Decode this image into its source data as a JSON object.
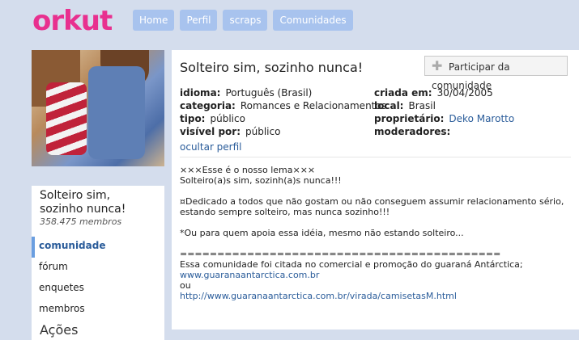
{
  "logo": "orkut",
  "nav": [
    "Home",
    "Perfil",
    "scraps",
    "Comunidades"
  ],
  "sidebar": {
    "community_name": "Solteiro sim, sozinho nunca!",
    "members": "358.475 membros",
    "menu": [
      "comunidade",
      "fórum",
      "enquetes",
      "membros"
    ],
    "acoes": "Ações"
  },
  "main": {
    "title": "Solteiro sim, sozinho nunca!",
    "join_button": "Participar da comunidade",
    "info_left": [
      {
        "k": "idioma:",
        "v": "Português (Brasil)"
      },
      {
        "k": "categoria:",
        "v": "Romances e Relacionamentos"
      },
      {
        "k": "tipo:",
        "v": "público"
      },
      {
        "k": "visível por:",
        "v": "público"
      }
    ],
    "info_right": [
      {
        "k": "criada em:",
        "v": "30/04/2005"
      },
      {
        "k": "local:",
        "v": "Brasil"
      },
      {
        "k": "proprietário:",
        "v": "Deko Marotto"
      },
      {
        "k": "moderadores:",
        "v": ""
      }
    ],
    "hide_profile": "ocultar perfil",
    "description": {
      "l1": "×××Esse é o nosso lema×××",
      "l2": "Solteiro(a)s sim, sozinh(a)s nunca!!!",
      "l3": "¤Dedicado a todos que não gostam ou não conseguem assumir relacionamento sério,",
      "l4": "estando sempre solteiro, mas nunca sozinho!!!",
      "l5": "*Ou para quem apoia essa idéia, mesmo não estando solteiro...",
      "l6": "===========================================",
      "l7": "Essa comunidade foi citada no comercial e promoção do guaraná Antárctica;",
      "link1": "www.guaranaantarctica.com.br",
      "l8": "ou",
      "link2": "http://www.guaranaantarctica.com.br/virada/camisetasM.html"
    }
  },
  "colors": {
    "logo": "#e8308f",
    "background": "#d4dded",
    "nav_button": "#a8c3ee",
    "link": "#2a5c9a"
  }
}
